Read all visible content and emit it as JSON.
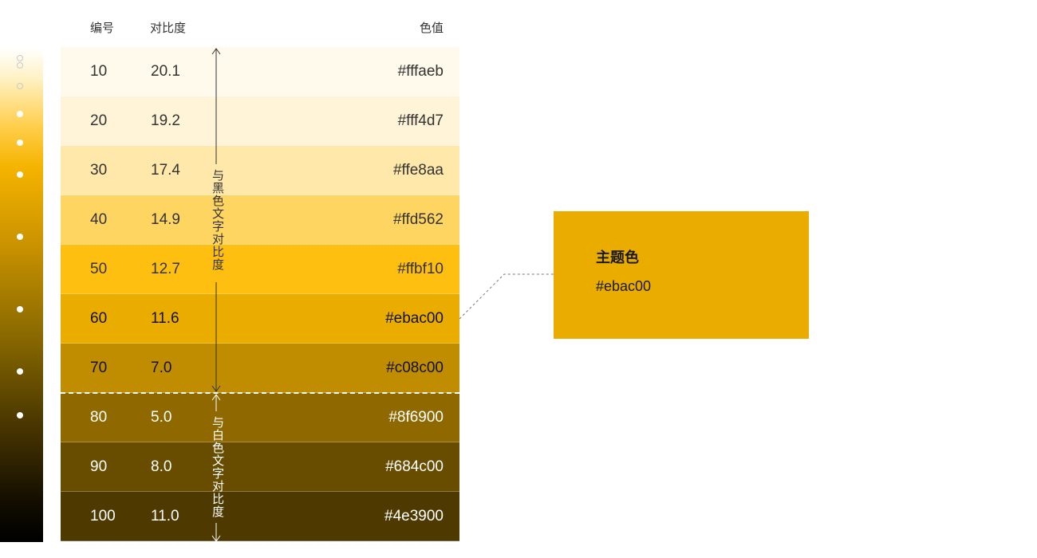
{
  "headers": {
    "code": "编号",
    "contrast": "对比度",
    "hex": "色值"
  },
  "rows": [
    {
      "code": "10",
      "contrast": "20.1",
      "hex": "#fffaeb",
      "bg": "#fffaeb",
      "fg": "#333333"
    },
    {
      "code": "20",
      "contrast": "19.2",
      "hex": "#fff4d7",
      "bg": "#fff4d7",
      "fg": "#333333"
    },
    {
      "code": "30",
      "contrast": "17.4",
      "hex": "#ffe8aa",
      "bg": "#ffe8aa",
      "fg": "#333333"
    },
    {
      "code": "40",
      "contrast": "14.9",
      "hex": "#ffd562",
      "bg": "#ffd562",
      "fg": "#333333"
    },
    {
      "code": "50",
      "contrast": "12.7",
      "hex": "#ffbf10",
      "bg": "#ffbf10",
      "fg": "#333333"
    },
    {
      "code": "60",
      "contrast": "11.6",
      "hex": "#ebac00",
      "bg": "#ebac00",
      "fg": "#111111"
    },
    {
      "code": "70",
      "contrast": "7.0",
      "hex": "#c08c00",
      "bg": "#c08c00",
      "fg": "#111111"
    },
    {
      "code": "80",
      "contrast": "5.0",
      "hex": "#8f6900",
      "bg": "#8f6900",
      "fg": "#ffffff"
    },
    {
      "code": "90",
      "contrast": "8.0",
      "hex": "#684c00",
      "bg": "#684c00",
      "fg": "#ffffff"
    },
    {
      "code": "100",
      "contrast": "11.0",
      "hex": "#4e3900",
      "bg": "#4e3900",
      "fg": "#ffffff"
    }
  ],
  "labels": {
    "black_text_contrast": "与黑色文字对比度",
    "white_text_contrast": "与白色文字对比度"
  },
  "primary": {
    "title": "主题色",
    "hex": "#ebac00",
    "color": "#ebac00"
  }
}
